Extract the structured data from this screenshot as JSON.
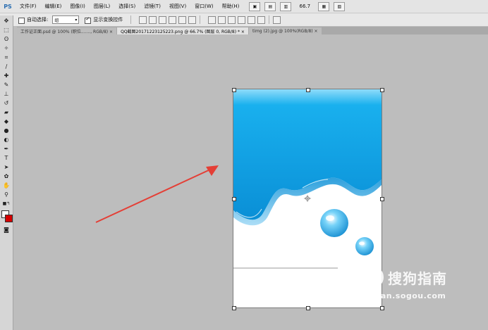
{
  "app": {
    "logo": "PS"
  },
  "menu": [
    "文件(F)",
    "编辑(E)",
    "图像(I)",
    "图层(L)",
    "选择(S)",
    "滤镜(T)",
    "视图(V)",
    "窗口(W)",
    "帮助(H)"
  ],
  "menu_right": {
    "zoom": "66.7"
  },
  "options": {
    "auto_select_label": "自动选择:",
    "auto_select_value": "组",
    "show_transform_label": "显示变换控件"
  },
  "tabs": [
    {
      "label": "工作证正面.psd @ 100% (职位......., RGB/8) ×"
    },
    {
      "label": "QQ截图20171223125223.png @ 66.7% (图层 0, RGB/8) * ×"
    },
    {
      "label": "timg (2).jpg @ 100%(RGB/8) ×"
    }
  ],
  "watermark": {
    "title": "搜狗指南",
    "url": "zhinan.sogou.com"
  },
  "colors": {
    "arrow": "#e43f36",
    "water_top": "#0ba6e8",
    "water_dark": "#0a86cf",
    "water_light": "#7ed2f8"
  }
}
